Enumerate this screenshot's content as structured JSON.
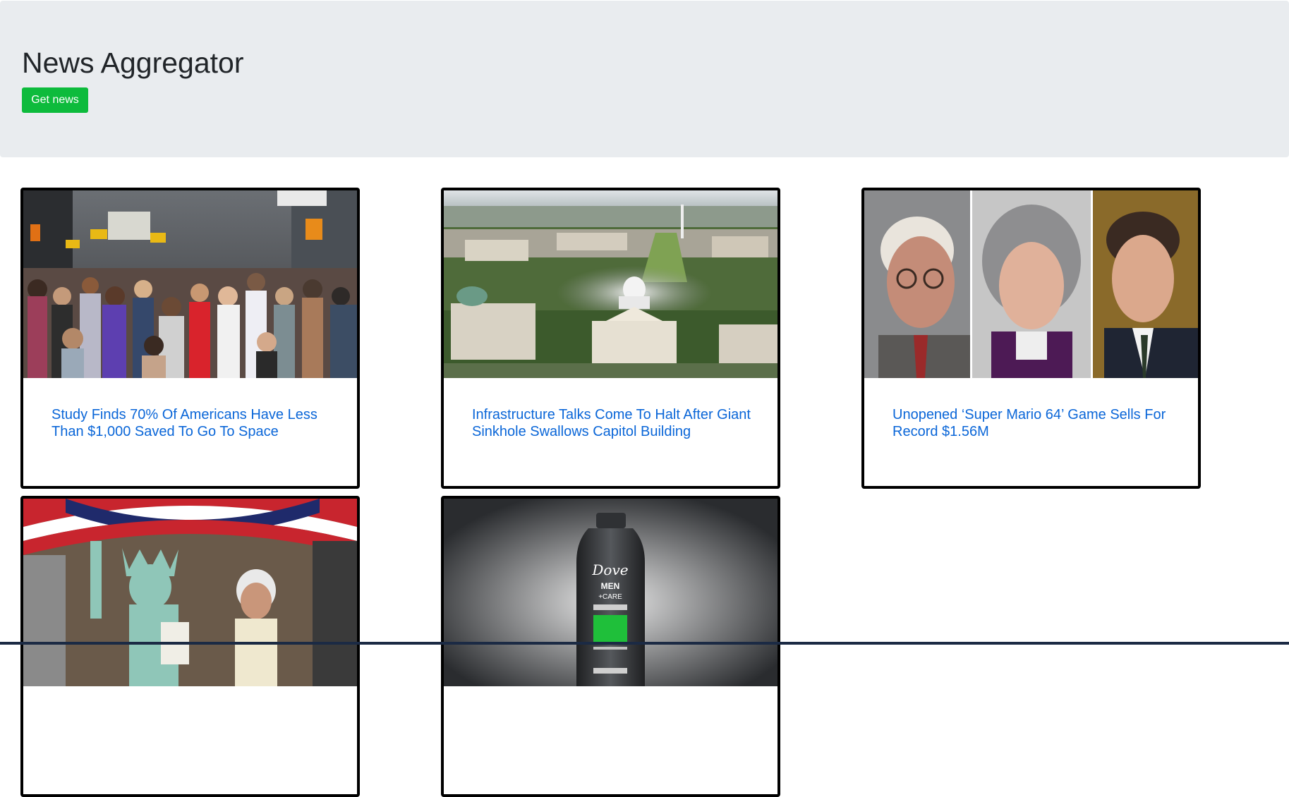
{
  "header": {
    "title": "News Aggregator",
    "button_label": "Get news"
  },
  "articles": [
    {
      "title": "Study Finds 70% Of Americans Have Less Than $1,000 Saved To Go To Space",
      "image": "crowd-street-photo"
    },
    {
      "title": "Infrastructure Talks Come To Halt After Giant Sinkhole Swallows Capitol Building",
      "image": "capitol-aerial-photo"
    },
    {
      "title": "Unopened ‘Super Mario 64’ Game Sells For Record $1.56M",
      "image": "three-portraits-photo"
    },
    {
      "title": "",
      "image": "statue-of-liberty-costume-photo"
    },
    {
      "title": "",
      "image": "dove-men-care-bottle-photo"
    }
  ],
  "colors": {
    "button": "#0dbb3c",
    "link": "#0a66d8",
    "jumbotron": "#e9ecef"
  }
}
